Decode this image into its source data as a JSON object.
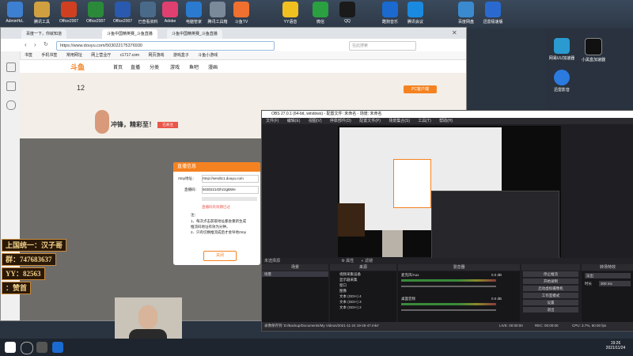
{
  "desktop": {
    "icons_top": [
      {
        "label": "AdminHd..",
        "color": "#3d7fd0"
      },
      {
        "label": "腾讯工具",
        "color": "#d0a040"
      },
      {
        "label": "Office2007",
        "color": "#d04020"
      },
      {
        "label": "Office2007",
        "color": "#2a8a3a"
      },
      {
        "label": "Office2007",
        "color": "#2a5ab0"
      },
      {
        "label": "已查看资料",
        "color": "#4a6a8a"
      },
      {
        "label": "Adobe",
        "color": "#e04070"
      },
      {
        "label": "电脑管家",
        "color": "#2a7ad0"
      },
      {
        "label": "腾讯工具箱",
        "color": "#7a8a9a"
      },
      {
        "label": "斗鱼TV",
        "color": "#f07030"
      },
      {
        "label": "YY语音",
        "color": "#f0c020"
      },
      {
        "label": "微信",
        "color": "#2aa040"
      },
      {
        "label": "QQ",
        "color": "#1a1a1a"
      },
      {
        "label": "酷狗音乐",
        "color": "#1a6ad0"
      },
      {
        "label": "腾讯会议",
        "color": "#1a8ae0"
      },
      {
        "label": "百度网盘",
        "color": "#3a8ad0"
      },
      {
        "label": "迅雷极速版",
        "color": "#2a6ad0"
      }
    ],
    "icons_right": [
      {
        "label": "网易UU加速器",
        "color": "#2a9ad0"
      },
      {
        "label": "小黑盒加速器",
        "color": "#1a1a1a"
      },
      {
        "label": "迅雷影音",
        "color": "#2a7ae0"
      }
    ]
  },
  "browser": {
    "tabs": [
      "百度一下，你就知道",
      "斗鱼中国精英赛_斗鱼直播",
      "斗鱼中国精英赛_斗鱼直播"
    ],
    "url": "https://www.douyu.com/5030221?5376930",
    "search_placeholder": "在此搜索",
    "bookmarks": [
      "书签",
      "手机书签",
      "常用网址",
      "网上营业厅",
      "c1717.com",
      "网页游戏",
      "游戏盒子",
      "斗鱼小游戏"
    ],
    "site_nav": [
      "首页",
      "直播",
      "分类",
      "游戏",
      "鱼吧",
      "漫画"
    ],
    "follow_count": "12",
    "streamer_text": "冲锋，精彩至！",
    "follow_btn": "已关注",
    "pc_btn": "PC客户端",
    "dialog": {
      "title": "直播信息",
      "rtmp_label": "rtmp地址：",
      "rtmp_value": "rtmp://sendtc1.douyu.com",
      "code_label": "直播码：",
      "code_value": "5030221rDhz2gBWe",
      "warning": "直播码有效期已过",
      "note1": "注：",
      "note2": "1、每次点击获取地址都会重新生成",
      "note3": "推流码地址有效为分钟。",
      "note4": "2、只有切换推流成后才会导地rtmp",
      "close_btn": "关闭"
    }
  },
  "obs": {
    "title": "OBS 27.0.1 (64-bit, windows) - 配置文件: 未命名 - 场景: 未命名",
    "menu": [
      "文件(F)",
      "编辑(E)",
      "视图(V)",
      "停靠部件(D)",
      "配置文件(P)",
      "场景集合(S)",
      "工具(T)",
      "帮助(H)"
    ],
    "source_bar": "未选择源",
    "props_btn": "属性",
    "filter_btn": "滤镜",
    "panels": [
      "场景",
      "来源",
      "混音器",
      "转场",
      "转场特效"
    ],
    "scenes": [
      "场景"
    ],
    "sources": [
      "视频采集设备",
      "显示器采集",
      "窗口",
      "图像",
      "文本 (GDI+) 4",
      "文本 (GDI+) 3",
      "文本 (GDI+) 2"
    ],
    "mixer": [
      {
        "name": "桌面音频",
        "db": "0.0 dB"
      },
      {
        "name": "麦克风/Aux",
        "db": "0.0 dB"
      }
    ],
    "controls": [
      "停止推流",
      "开始录制",
      "启动虚拟摄像机",
      "工作室模式",
      "设置",
      "退出"
    ],
    "transition": "淡出",
    "duration_label": "时长",
    "duration": "300 ms",
    "status_saved": "录像保存到 'D:/Backup/Documents/My Videos/2021-11-24 19-26-47.mkv'",
    "status_live": "LIVE: 00:00:00",
    "status_rec": "REC: 00:00:00",
    "status_cpu": "CPU: 3.7%, 60.00 fps"
  },
  "overlay": {
    "line1": "上国统一：汉子哥",
    "line2": "群：747683637",
    "line3": "YY：82563",
    "line4": "：赞首"
  },
  "taskbar": {
    "time": "19:26",
    "date": "2021/11/24",
    "items": [
      "新建文本文档",
      "快手直播伴侣",
      "WebMeet"
    ]
  }
}
